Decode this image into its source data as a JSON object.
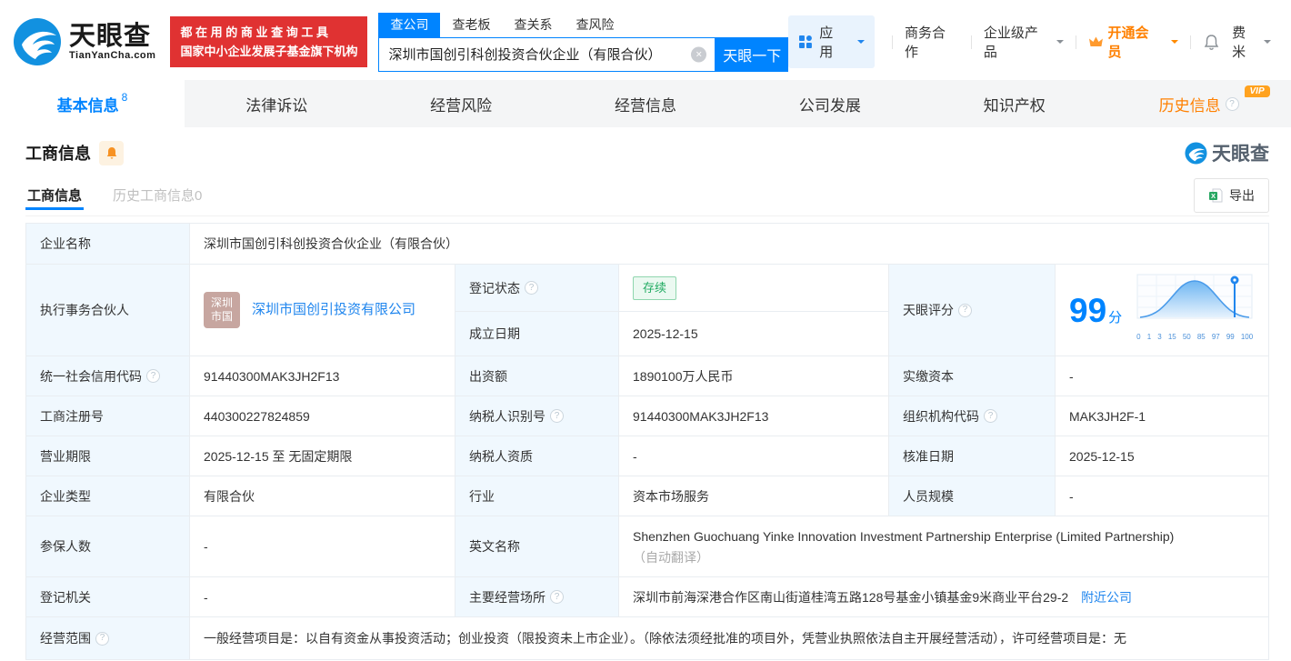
{
  "colors": {
    "brand_blue": "#0084ff",
    "banner_red": "#e03232",
    "vip_orange": "#ff8a00",
    "status_green": "#21ab62",
    "link_blue": "#2086ee"
  },
  "header": {
    "logo": {
      "title": "天眼查",
      "subtitle": "TianYanCha.com"
    },
    "slogan": {
      "line1": "都 在 用 的 商 业 查 询 工 具",
      "line2": "国家中小企业发展子基金旗下机构"
    },
    "search": {
      "tabs": [
        "查公司",
        "查老板",
        "查关系",
        "查风险"
      ],
      "value": "深圳市国创引科创投资合伙企业（有限合伙）",
      "button": "天眼一下"
    },
    "nav": {
      "apps": "应用",
      "cooperation": "商务合作",
      "enterprise": "企业级产品",
      "vip": "开通会员",
      "user": "费米"
    }
  },
  "main_tabs": [
    {
      "label": "基本信息",
      "count": "8"
    },
    {
      "label": "法律诉讼"
    },
    {
      "label": "经营风险"
    },
    {
      "label": "经营信息"
    },
    {
      "label": "公司发展"
    },
    {
      "label": "知识产权"
    },
    {
      "label": "历史信息",
      "vip_badge": "VIP"
    }
  ],
  "section": {
    "title": "工商信息",
    "watermark": "天眼查"
  },
  "subtabs": [
    {
      "label": "工商信息"
    },
    {
      "label": "历史工商信息0"
    }
  ],
  "export_label": "导出",
  "score_chart": {
    "score": "99",
    "unit": "分",
    "ticks": [
      "0",
      "1",
      "3",
      "15",
      "50",
      "85",
      "97",
      "99",
      "100"
    ],
    "marker_value": "99"
  },
  "table": {
    "fields": {
      "company_name": {
        "label": "企业名称",
        "value": "深圳市国创引科创投资合伙企业（有限合伙）"
      },
      "executive_partner": {
        "label": "执行事务合伙人",
        "avatar_line1": "深圳",
        "avatar_line2": "市国",
        "link": "深圳市国创引投资有限公司"
      },
      "reg_status": {
        "label": "登记状态",
        "value": "存续"
      },
      "establish_date": {
        "label": "成立日期",
        "value": "2025-12-15"
      },
      "score": {
        "label": "天眼评分"
      },
      "credit_code": {
        "label": "统一社会信用代码",
        "value": "91440300MAK3JH2F13"
      },
      "contribution": {
        "label": "出资额",
        "value": "1890100万人民币"
      },
      "paid_capital": {
        "label": "实缴资本",
        "value": "-"
      },
      "reg_number": {
        "label": "工商注册号",
        "value": "440300227824859"
      },
      "taxpayer_id": {
        "label": "纳税人识别号",
        "value": "91440300MAK3JH2F13"
      },
      "org_code": {
        "label": "组织机构代码",
        "value": "MAK3JH2F-1"
      },
      "business_term": {
        "label": "营业期限",
        "value": "2025-12-15 至 无固定期限"
      },
      "taxpayer_quality": {
        "label": "纳税人资质",
        "value": "-"
      },
      "approval_date": {
        "label": "核准日期",
        "value": "2025-12-15"
      },
      "company_type": {
        "label": "企业类型",
        "value": "有限合伙"
      },
      "industry": {
        "label": "行业",
        "value": "资本市场服务"
      },
      "staff_size": {
        "label": "人员规模",
        "value": "-"
      },
      "insured_count": {
        "label": "参保人数",
        "value": "-"
      },
      "english_name": {
        "label": "英文名称",
        "value": "Shenzhen Guochuang Yinke Innovation Investment Partnership Enterprise (Limited Partnership)",
        "note": "（自动翻译）"
      },
      "reg_authority": {
        "label": "登记机关",
        "value": "-"
      },
      "business_place": {
        "label": "主要经营场所",
        "value": "深圳市前海深港合作区南山街道桂湾五路128号基金小镇基金9米商业平台29-2",
        "link": "附近公司"
      },
      "business_scope": {
        "label": "经营范围",
        "value": "一般经营项目是：以自有资金从事投资活动；创业投资（限投资未上市企业）。（除依法须经批准的项目外，凭营业执照依法自主开展经营活动），许可经营项目是：无"
      }
    }
  }
}
